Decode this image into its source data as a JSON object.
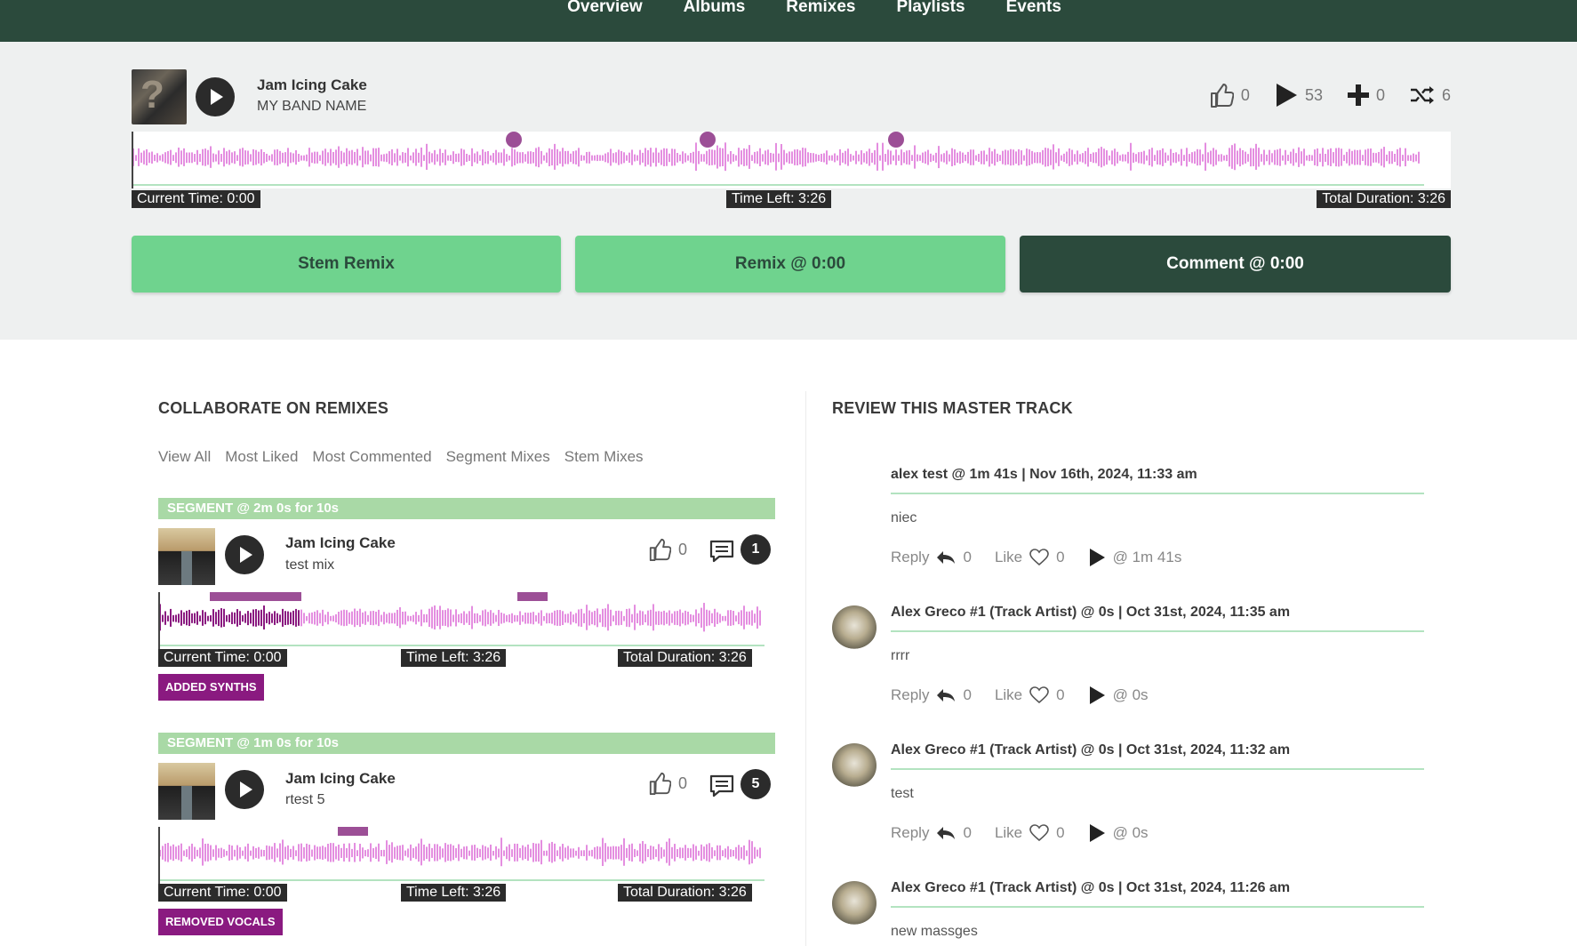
{
  "nav": {
    "items": [
      "Overview",
      "Albums",
      "Remixes",
      "Playlists",
      "Events"
    ]
  },
  "player": {
    "title": "Jam Icing Cake",
    "artist": "MY BAND NAME",
    "likes": "0",
    "plays": "53",
    "adds": "0",
    "remixes": "6",
    "current_time": "Current Time: 0:00",
    "time_left": "Time Left: 3:26",
    "total_duration": "Total Duration: 3:26",
    "buttons": {
      "stem_remix": "Stem Remix",
      "remix_at": "Remix @ 0:00",
      "comment_at": "Comment @ 0:00"
    }
  },
  "collaborate": {
    "title": "COLLABORATE ON REMIXES",
    "filters": [
      "View All",
      "Most Liked",
      "Most Commented",
      "Segment Mixes",
      "Stem Mixes"
    ],
    "remixes": [
      {
        "segment": "SEGMENT @ 2m 0s for 10s",
        "title": "Jam Icing Cake",
        "subtitle": "test mix",
        "likes": "0",
        "comments": "1",
        "current_time": "Current Time: 0:00",
        "time_left": "Time Left: 3:26",
        "total_duration": "Total Duration: 3:26",
        "tag": "ADDED SYNTHS"
      },
      {
        "segment": "SEGMENT @ 1m 0s for 10s",
        "title": "Jam Icing Cake",
        "subtitle": "rtest 5",
        "likes": "0",
        "comments": "5",
        "current_time": "Current Time: 0:00",
        "time_left": "Time Left: 3:26",
        "total_duration": "Total Duration: 3:26",
        "tag": "REMOVED VOCALS"
      }
    ]
  },
  "review": {
    "title": "REVIEW THIS MASTER TRACK",
    "comments": [
      {
        "head": "alex test  @ 1m 41s | Nov 16th, 2024, 11:33 am",
        "body": "niec",
        "reply": "Reply",
        "reply_count": "0",
        "like": "Like",
        "like_count": "0",
        "at": "@ 1m 41s"
      },
      {
        "head": "Alex Greco #1 (Track Artist) @ 0s | Oct 31st, 2024, 11:35 am",
        "body": "rrrr",
        "reply": "Reply",
        "reply_count": "0",
        "like": "Like",
        "like_count": "0",
        "at": "@ 0s"
      },
      {
        "head": "Alex Greco #1 (Track Artist) @ 0s | Oct 31st, 2024, 11:32 am",
        "body": "test",
        "reply": "Reply",
        "reply_count": "0",
        "like": "Like",
        "like_count": "0",
        "at": "@ 0s"
      },
      {
        "head": "Alex Greco #1 (Track Artist) @ 0s | Oct 31st, 2024, 11:26 am",
        "body": "new massges"
      }
    ]
  },
  "colors": {
    "nav_bg": "#2b4a3c",
    "accent_green": "#6fd38e",
    "wave": "#e48ee0",
    "wave_played": "#8a1a80",
    "marker": "#9c4f96"
  }
}
